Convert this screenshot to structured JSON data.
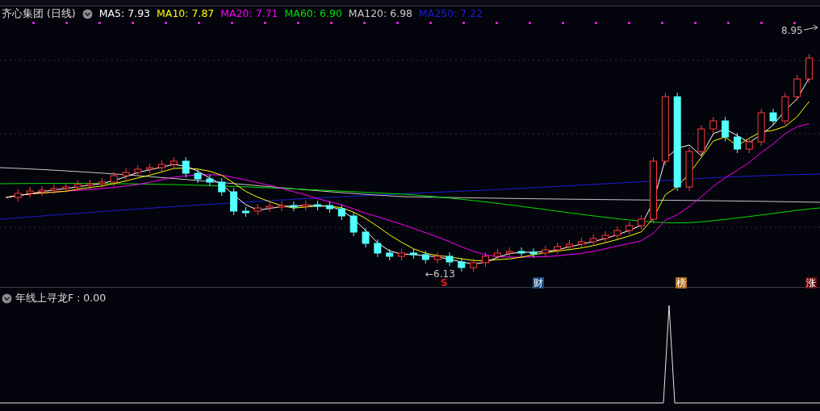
{
  "chart_header": {
    "title": "齐心集团 (日线)",
    "moving_averages": [
      {
        "label": "MA5: 7.93",
        "color": "#ffffff"
      },
      {
        "label": "MA10: 7.87",
        "color": "#ffff00"
      },
      {
        "label": "MA20: 7.71",
        "color": "#ff00ff"
      },
      {
        "label": "MA60: 6.90",
        "color": "#00e000"
      },
      {
        "label": "MA120: 6.98",
        "color": "#c8c8c8"
      },
      {
        "label": "MA250: 7.22",
        "color": "#1c1cd8"
      }
    ]
  },
  "price_labels": {
    "high": "8.95",
    "low": "←6.13"
  },
  "event_markers": [
    {
      "text": "S",
      "kind": "plain",
      "color": "#e02020"
    },
    {
      "text": "财",
      "kind": "badge",
      "color": "#1a4a80"
    },
    {
      "text": "榜",
      "kind": "badge",
      "color": "#b06a18"
    },
    {
      "text": "涨",
      "kind": "badge",
      "color": "#6a1010"
    }
  ],
  "indicator": {
    "label": "年线上寻龙F : 0.00"
  }
}
